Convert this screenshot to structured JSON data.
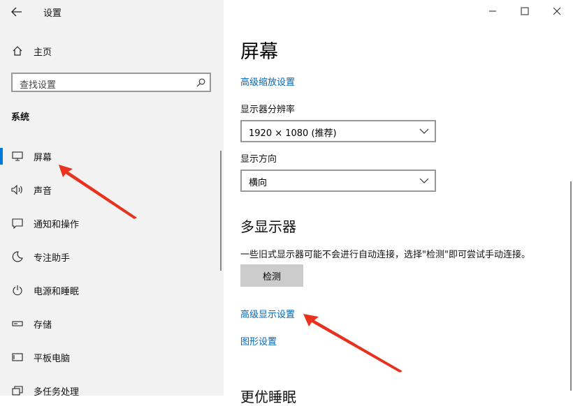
{
  "window": {
    "title": "设置",
    "controls": {
      "minimize": "minimize-icon",
      "maximize": "maximize-icon",
      "close": "close-icon"
    }
  },
  "sidebar": {
    "home_label": "主页",
    "search_placeholder": "查找设置",
    "section": "系统",
    "items": [
      {
        "label": "屏幕",
        "icon": "monitor-icon",
        "active": true
      },
      {
        "label": "声音",
        "icon": "speaker-icon"
      },
      {
        "label": "通知和操作",
        "icon": "message-icon"
      },
      {
        "label": "专注助手",
        "icon": "moon-icon"
      },
      {
        "label": "电源和睡眠",
        "icon": "power-icon"
      },
      {
        "label": "存储",
        "icon": "storage-icon"
      },
      {
        "label": "平板电脑",
        "icon": "tablet-icon"
      },
      {
        "label": "多任务处理",
        "icon": "multitask-icon"
      }
    ]
  },
  "main": {
    "title": "屏幕",
    "advanced_scaling_link": "高级缩放设置",
    "resolution": {
      "label": "显示器分辨率",
      "value": "1920 × 1080 (推荐)"
    },
    "orientation": {
      "label": "显示方向",
      "value": "横向"
    },
    "multi_display": {
      "heading": "多显示器",
      "description": "一些旧式显示器可能不会进行自动连接，选择\"检测\"即可尝试手动连接。",
      "detect_button": "检测",
      "advanced_display_link": "高级显示设置",
      "graphics_link": "图形设置"
    },
    "next_section_heading_partial": "更优睡眠"
  },
  "colors": {
    "accent": "#0078d7",
    "link": "#0067b8",
    "annotation_arrow": "#e8321e"
  }
}
